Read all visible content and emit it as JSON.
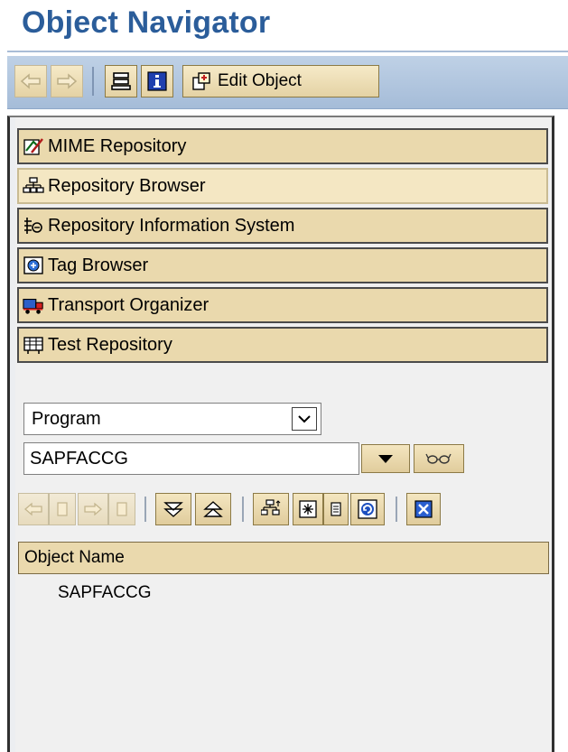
{
  "header": {
    "title": "Object Navigator"
  },
  "toolbar": {
    "edit_object_label": "Edit Object"
  },
  "nav": {
    "items": [
      {
        "label": "MIME Repository",
        "icon": "mime-icon"
      },
      {
        "label": "Repository Browser",
        "icon": "hierarchy-icon",
        "active": true
      },
      {
        "label": "Repository Information System",
        "icon": "info-system-icon"
      },
      {
        "label": "Tag Browser",
        "icon": "tag-browser-icon"
      },
      {
        "label": "Transport Organizer",
        "icon": "truck-icon"
      },
      {
        "label": "Test Repository",
        "icon": "test-repository-icon"
      }
    ]
  },
  "browser": {
    "object_type": "Program",
    "object_name": "SAPFACCG"
  },
  "table": {
    "column_header": "Object Name",
    "rows": [
      "SAPFACCG"
    ]
  },
  "colors": {
    "title": "#2b5d9a",
    "toolbar_bg": "#bfd1e6",
    "nav_item_bg": "#ead9ad"
  }
}
